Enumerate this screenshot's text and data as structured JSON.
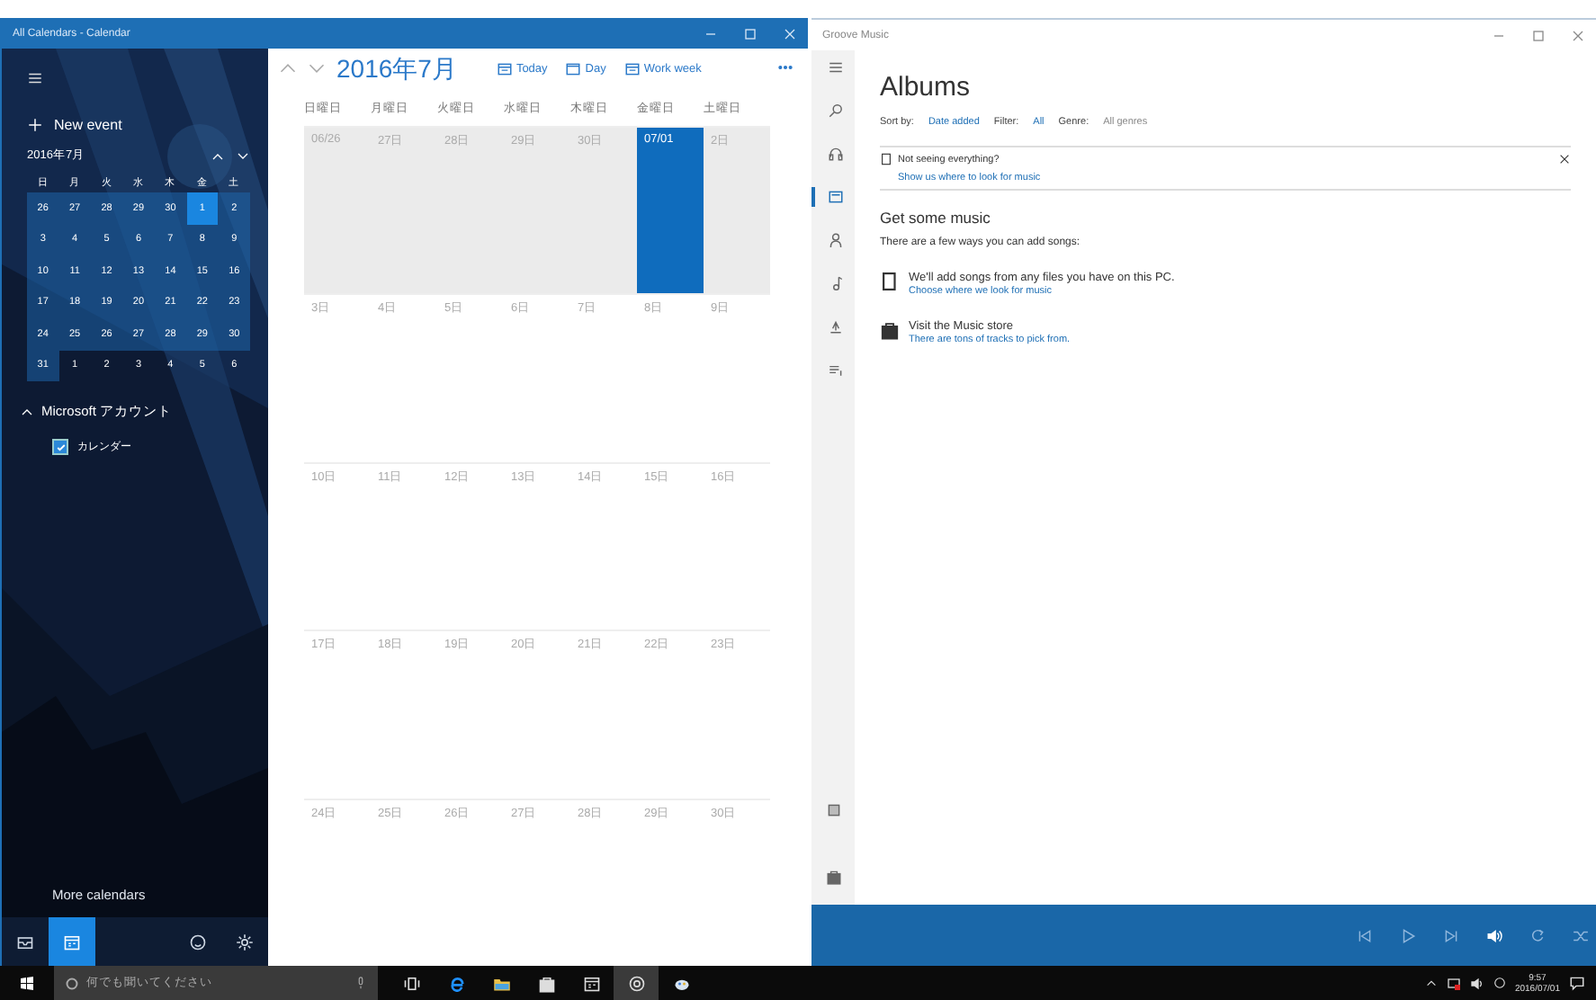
{
  "calendar_window": {
    "title": "All Calendars - Calendar",
    "sidebar": {
      "new_event": "New event",
      "mini_calendar": {
        "title": "2016年7月",
        "weekdays": [
          "日",
          "月",
          "火",
          "水",
          "木",
          "金",
          "土"
        ],
        "weeks": [
          [
            {
              "label": "26",
              "highlighted": true,
              "selected": false
            },
            {
              "label": "27",
              "highlighted": true,
              "selected": false
            },
            {
              "label": "28",
              "highlighted": true,
              "selected": false
            },
            {
              "label": "29",
              "highlighted": true,
              "selected": false
            },
            {
              "label": "30",
              "highlighted": true,
              "selected": false
            },
            {
              "label": "1",
              "highlighted": true,
              "selected": true
            },
            {
              "label": "2",
              "highlighted": true,
              "selected": false
            }
          ],
          [
            {
              "label": "3",
              "highlighted": true,
              "selected": false
            },
            {
              "label": "4",
              "highlighted": true,
              "selected": false
            },
            {
              "label": "5",
              "highlighted": true,
              "selected": false
            },
            {
              "label": "6",
              "highlighted": true,
              "selected": false
            },
            {
              "label": "7",
              "highlighted": true,
              "selected": false
            },
            {
              "label": "8",
              "highlighted": true,
              "selected": false
            },
            {
              "label": "9",
              "highlighted": true,
              "selected": false
            }
          ],
          [
            {
              "label": "10",
              "highlighted": true,
              "selected": false
            },
            {
              "label": "11",
              "highlighted": true,
              "selected": false
            },
            {
              "label": "12",
              "highlighted": true,
              "selected": false
            },
            {
              "label": "13",
              "highlighted": true,
              "selected": false
            },
            {
              "label": "14",
              "highlighted": true,
              "selected": false
            },
            {
              "label": "15",
              "highlighted": true,
              "selected": false
            },
            {
              "label": "16",
              "highlighted": true,
              "selected": false
            }
          ],
          [
            {
              "label": "17",
              "highlighted": true,
              "selected": false
            },
            {
              "label": "18",
              "highlighted": true,
              "selected": false
            },
            {
              "label": "19",
              "highlighted": true,
              "selected": false
            },
            {
              "label": "20",
              "highlighted": true,
              "selected": false
            },
            {
              "label": "21",
              "highlighted": true,
              "selected": false
            },
            {
              "label": "22",
              "highlighted": true,
              "selected": false
            },
            {
              "label": "23",
              "highlighted": true,
              "selected": false
            }
          ],
          [
            {
              "label": "24",
              "highlighted": true,
              "selected": false
            },
            {
              "label": "25",
              "highlighted": true,
              "selected": false
            },
            {
              "label": "26",
              "highlighted": true,
              "selected": false
            },
            {
              "label": "27",
              "highlighted": true,
              "selected": false
            },
            {
              "label": "28",
              "highlighted": true,
              "selected": false
            },
            {
              "label": "29",
              "highlighted": true,
              "selected": false
            },
            {
              "label": "30",
              "highlighted": true,
              "selected": false
            }
          ],
          [
            {
              "label": "31",
              "highlighted": true,
              "selected": false
            },
            {
              "label": "1",
              "highlighted": false,
              "selected": false
            },
            {
              "label": "2",
              "highlighted": false,
              "selected": false
            },
            {
              "label": "3",
              "highlighted": false,
              "selected": false
            },
            {
              "label": "4",
              "highlighted": false,
              "selected": false
            },
            {
              "label": "5",
              "highlighted": false,
              "selected": false
            },
            {
              "label": "6",
              "highlighted": false,
              "selected": false
            }
          ]
        ]
      },
      "account": {
        "label": "Microsoft アカウント",
        "expanded": true
      },
      "calendars": [
        {
          "label": "カレンダー",
          "checked": true
        }
      ],
      "more_calendars": "More calendars",
      "nav": [
        {
          "kind": "mail",
          "selected": false
        },
        {
          "kind": "calendar",
          "selected": true
        },
        {
          "kind": "feedback",
          "selected": false
        },
        {
          "kind": "settings",
          "selected": false
        }
      ]
    },
    "month_title": "2016年7月",
    "toolbar": [
      {
        "kind": "today",
        "label": "Today"
      },
      {
        "kind": "day",
        "label": "Day"
      },
      {
        "kind": "week",
        "label": "Work week"
      },
      {
        "kind": "more"
      }
    ],
    "weekdays": [
      "日曜日",
      "月曜日",
      "火曜日",
      "水曜日",
      "木曜日",
      "金曜日",
      "土曜日"
    ],
    "weeks": [
      {
        "current": true,
        "days": [
          {
            "label": "06/26",
            "selected": false
          },
          {
            "label": "27日",
            "selected": false
          },
          {
            "label": "28日",
            "selected": false
          },
          {
            "label": "29日",
            "selected": false
          },
          {
            "label": "30日",
            "selected": false
          },
          {
            "label": "07/01",
            "selected": true
          },
          {
            "label": "2日",
            "selected": false
          }
        ]
      },
      {
        "current": false,
        "days": [
          {
            "label": "3日",
            "selected": false
          },
          {
            "label": "4日",
            "selected": false
          },
          {
            "label": "5日",
            "selected": false
          },
          {
            "label": "6日",
            "selected": false
          },
          {
            "label": "7日",
            "selected": false
          },
          {
            "label": "8日",
            "selected": false
          },
          {
            "label": "9日",
            "selected": false
          }
        ]
      },
      {
        "current": false,
        "days": [
          {
            "label": "10日",
            "selected": false
          },
          {
            "label": "11日",
            "selected": false
          },
          {
            "label": "12日",
            "selected": false
          },
          {
            "label": "13日",
            "selected": false
          },
          {
            "label": "14日",
            "selected": false
          },
          {
            "label": "15日",
            "selected": false
          },
          {
            "label": "16日",
            "selected": false
          }
        ]
      },
      {
        "current": false,
        "days": [
          {
            "label": "17日",
            "selected": false
          },
          {
            "label": "18日",
            "selected": false
          },
          {
            "label": "19日",
            "selected": false
          },
          {
            "label": "20日",
            "selected": false
          },
          {
            "label": "21日",
            "selected": false
          },
          {
            "label": "22日",
            "selected": false
          },
          {
            "label": "23日",
            "selected": false
          }
        ]
      },
      {
        "current": false,
        "days": [
          {
            "label": "24日",
            "selected": false
          },
          {
            "label": "25日",
            "selected": false
          },
          {
            "label": "26日",
            "selected": false
          },
          {
            "label": "27日",
            "selected": false
          },
          {
            "label": "28日",
            "selected": false
          },
          {
            "label": "29日",
            "selected": false
          },
          {
            "label": "30日",
            "selected": false
          }
        ]
      }
    ]
  },
  "music_window": {
    "title": "Groove Music",
    "rail": [
      {
        "kind": "menu",
        "selected": false
      },
      {
        "kind": "search",
        "selected": false
      },
      {
        "kind": "headphones",
        "selected": false
      },
      {
        "kind": "albums",
        "selected": true
      },
      {
        "kind": "artists",
        "selected": false
      },
      {
        "kind": "songs",
        "selected": false
      },
      {
        "kind": "radio",
        "selected": false
      },
      {
        "kind": "playlist",
        "selected": false
      }
    ],
    "rail_bottom": [
      {
        "kind": "account"
      },
      {
        "kind": "store"
      }
    ],
    "heading": "Albums",
    "filters": [
      {
        "label": "Sort by:",
        "value": "Date added",
        "link": true
      },
      {
        "label": "Filter:",
        "value": "All",
        "link": true
      },
      {
        "label": "Genre:",
        "value": "All genres",
        "link": false
      }
    ],
    "notice": {
      "title": "Not seeing everything?",
      "link": "Show us where to look for music"
    },
    "section_title": "Get some music",
    "section_text": "There are a few ways you can add songs:",
    "options": [
      {
        "kind": "pc",
        "title": "We'll add songs from any files you have on this PC.",
        "link": "Choose where we look for music"
      },
      {
        "kind": "store",
        "title": "Visit the Music store",
        "link": "There are tons of tracks to pick from."
      }
    ],
    "player": [
      {
        "kind": "previous"
      },
      {
        "kind": "play"
      },
      {
        "kind": "next"
      },
      {
        "kind": "volume"
      },
      {
        "kind": "repeat"
      },
      {
        "kind": "shuffle"
      }
    ]
  },
  "taskbar": {
    "search_placeholder": "何でも聞いてください",
    "apps": [
      {
        "kind": "taskview",
        "active": false
      },
      {
        "kind": "edge",
        "active": false
      },
      {
        "kind": "explorer",
        "active": false
      },
      {
        "kind": "store",
        "active": false
      },
      {
        "kind": "calendar",
        "active": false
      },
      {
        "kind": "groove",
        "active": true
      },
      {
        "kind": "paint",
        "active": false
      }
    ],
    "time": "9:57",
    "date": "2016/07/01"
  }
}
